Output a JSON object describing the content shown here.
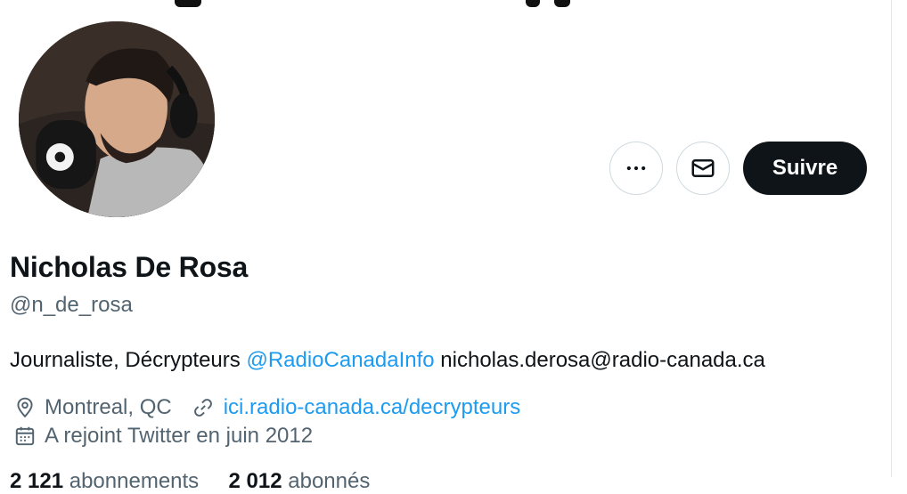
{
  "profile": {
    "name": "Nicholas De Rosa",
    "handle": "@n_de_rosa",
    "bio_text": "Journaliste, Décrypteurs ",
    "bio_mention": "@RadioCanadaInfo",
    "bio_email": " nicholas.derosa@radio-canada.ca",
    "location": "Montreal, QC",
    "website": "ici.radio-canada.ca/decrypteurs",
    "joined": "A rejoint Twitter en juin 2012",
    "following_count": "2 121",
    "following_label": "abonnements",
    "followers_count": "2 012",
    "followers_label": "abonnés"
  },
  "actions": {
    "more_icon": "more-horizontal-icon",
    "message_icon": "envelope-icon",
    "follow_label": "Suivre"
  },
  "icons": {
    "location": "location-pin-icon",
    "link": "link-icon",
    "calendar": "calendar-icon"
  },
  "colors": {
    "link": "#1d9bf0",
    "muted": "#536471",
    "button_dark": "#0f1419"
  }
}
